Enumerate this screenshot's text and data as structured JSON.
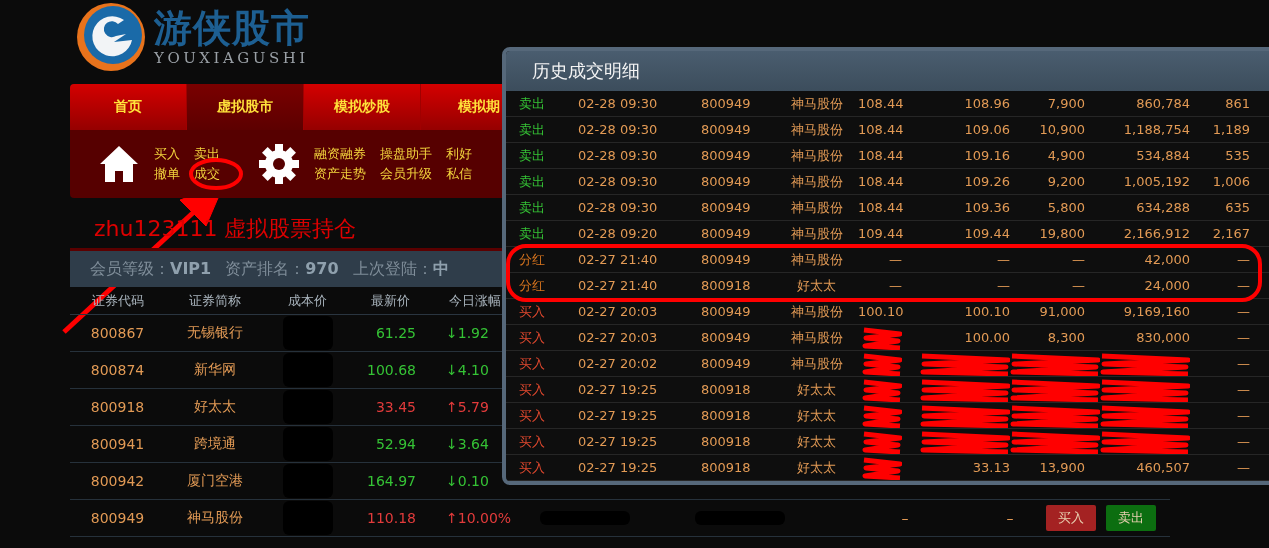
{
  "logo": {
    "name": "游侠股市",
    "subtitle": "YOUXIAGUSHI"
  },
  "nav": [
    {
      "label": "首页",
      "selected": false
    },
    {
      "label": "虚拟股市",
      "selected": true
    },
    {
      "label": "模拟炒股",
      "selected": false
    },
    {
      "label": "模拟期",
      "selected": false
    }
  ],
  "submenu": {
    "trade_links": [
      [
        "买入",
        "卖出"
      ],
      [
        "撤单",
        "成交"
      ]
    ],
    "tool_links": [
      [
        "融资融券",
        "操盘助手",
        "利好"
      ],
      [
        "资产走势",
        "会员升级",
        "私信"
      ]
    ]
  },
  "holdings_title": "zhu123111 虚拟股票持仓",
  "info_bar": [
    {
      "label": "会员等级：",
      "value": "VIP1"
    },
    {
      "label": "资产排名：",
      "value": "970"
    },
    {
      "label": "上次登陆：",
      "value": "中"
    }
  ],
  "holdings": {
    "columns": [
      "证券代码",
      "证券简称",
      "成本价",
      "最新价",
      "今日涨幅"
    ],
    "rows": [
      {
        "code": "800867",
        "name": "无锡银行",
        "cost": {
          "kind": "redacted"
        },
        "price": "61.25",
        "change": "↓1.92",
        "color": "#35c335"
      },
      {
        "code": "800874",
        "name": "新华网",
        "cost": {
          "kind": "redacted"
        },
        "price": "100.68",
        "change": "↓4.10",
        "color": "#35c335"
      },
      {
        "code": "800918",
        "name": "好太太",
        "cost": {
          "kind": "redacted"
        },
        "price": "33.45",
        "change": "↑5.79",
        "color": "#e23b3b"
      },
      {
        "code": "800941",
        "name": "跨境通",
        "cost": {
          "kind": "redacted"
        },
        "price": "52.94",
        "change": "↓3.64",
        "color": "#35c335"
      },
      {
        "code": "800942",
        "name": "厦门空港",
        "cost": {
          "kind": "redacted"
        },
        "price": "164.97",
        "change": "↓0.10",
        "color": "#35c335"
      },
      {
        "code": "800949",
        "name": "神马股份",
        "cost": {
          "kind": "redacted"
        },
        "price": "110.18",
        "change": "↑10.00%",
        "color": "#e23b3b",
        "tail": [
          {
            "kind": "redacted"
          },
          {
            "kind": "redacted"
          },
          {
            "kind": "text",
            "text": "–"
          },
          {
            "kind": "text",
            "text": "–"
          }
        ],
        "actions": [
          "买入",
          "卖出"
        ]
      }
    ]
  },
  "history": {
    "title": "历史成交明细",
    "rows": [
      {
        "kind": "sell",
        "type": "卖出",
        "time": "02-28 09:30",
        "code": "800949",
        "name": "神马股份",
        "cells": [
          "108.44",
          "108.96",
          "7,900",
          "860,784",
          "861"
        ]
      },
      {
        "kind": "sell",
        "type": "卖出",
        "time": "02-28 09:30",
        "code": "800949",
        "name": "神马股份",
        "cells": [
          "108.44",
          "109.06",
          "10,900",
          "1,188,754",
          "1,189"
        ]
      },
      {
        "kind": "sell",
        "type": "卖出",
        "time": "02-28 09:30",
        "code": "800949",
        "name": "神马股份",
        "cells": [
          "108.44",
          "109.16",
          "4,900",
          "534,884",
          "535"
        ]
      },
      {
        "kind": "sell",
        "type": "卖出",
        "time": "02-28 09:30",
        "code": "800949",
        "name": "神马股份",
        "cells": [
          "108.44",
          "109.26",
          "9,200",
          "1,005,192",
          "1,006"
        ]
      },
      {
        "kind": "sell",
        "type": "卖出",
        "time": "02-28 09:30",
        "code": "800949",
        "name": "神马股份",
        "cells": [
          "108.44",
          "109.36",
          "5,800",
          "634,288",
          "635"
        ]
      },
      {
        "kind": "sell",
        "type": "卖出",
        "time": "02-28 09:20",
        "code": "800949",
        "name": "神马股份",
        "cells": [
          "109.44",
          "109.44",
          "19,800",
          "2,166,912",
          "2,167"
        ]
      },
      {
        "kind": "dividend",
        "type": "分红",
        "time": "02-27 21:40",
        "code": "800949",
        "name": "神马股份",
        "cells": [
          "—",
          "—",
          "—",
          "42,000",
          "—"
        ]
      },
      {
        "kind": "dividend",
        "type": "分红",
        "time": "02-27 21:40",
        "code": "800918",
        "name": "好太太",
        "cells": [
          "—",
          "—",
          "—",
          "24,000",
          "—"
        ]
      },
      {
        "kind": "buy",
        "type": "买入",
        "time": "02-27 20:03",
        "code": "800949",
        "name": "神马股份",
        "cells": [
          "100.10",
          "100.10",
          "91,000",
          "9,169,160",
          "—"
        ]
      },
      {
        "kind": "buy",
        "type": "买入",
        "time": "02-27 20:03",
        "code": "800949",
        "name": "神马股份",
        "cells": [
          {
            "kind": "scribbled"
          },
          "100.00",
          "8,300",
          "830,000",
          "—"
        ]
      },
      {
        "kind": "buy",
        "type": "买入",
        "time": "02-27 20:02",
        "code": "800949",
        "name": "神马股份",
        "cells": [
          {
            "kind": "scribbled"
          },
          {
            "kind": "scribbled"
          },
          {
            "kind": "scribbled"
          },
          {
            "kind": "scribbled"
          },
          "—"
        ]
      },
      {
        "kind": "buy",
        "type": "买入",
        "time": "02-27 19:25",
        "code": "800918",
        "name": "好太太",
        "cells": [
          {
            "kind": "scribbled"
          },
          {
            "kind": "scribbled"
          },
          {
            "kind": "scribbled"
          },
          {
            "kind": "scribbled"
          },
          "—"
        ]
      },
      {
        "kind": "buy",
        "type": "买入",
        "time": "02-27 19:25",
        "code": "800918",
        "name": "好太太",
        "cells": [
          {
            "kind": "scribbled"
          },
          {
            "kind": "scribbled"
          },
          {
            "kind": "scribbled"
          },
          {
            "kind": "scribbled"
          },
          "—"
        ]
      },
      {
        "kind": "buy",
        "type": "买入",
        "time": "02-27 19:25",
        "code": "800918",
        "name": "好太太",
        "cells": [
          {
            "kind": "scribbled"
          },
          {
            "kind": "scribbled"
          },
          {
            "kind": "scribbled"
          },
          {
            "kind": "scribbled"
          },
          "—"
        ]
      },
      {
        "kind": "buy",
        "type": "买入",
        "time": "02-27 19:25",
        "code": "800918",
        "name": "好太太",
        "cells": [
          {
            "kind": "scribbled"
          },
          "33.13",
          "13,900",
          "460,507",
          "—"
        ]
      }
    ]
  }
}
